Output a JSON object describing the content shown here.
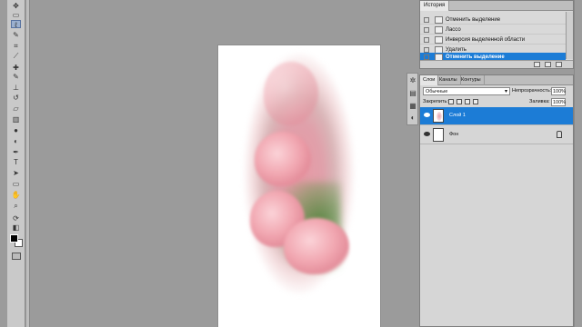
{
  "history": {
    "tab_label": "История",
    "items": [
      {
        "label": "Отменить выделение",
        "selected": false
      },
      {
        "label": "Лассо",
        "selected": false
      },
      {
        "label": "Инверсия выделенной области",
        "selected": false
      },
      {
        "label": "Удалить",
        "selected": false
      },
      {
        "label": "Отменить выделение",
        "selected": true
      }
    ]
  },
  "layers": {
    "tabs": [
      "Слои",
      "Каналы",
      "Контуры"
    ],
    "blend_mode": "Обычные",
    "opacity_label": "Непрозрачность:",
    "opacity_value": "100%",
    "lock_label": "Закрепить:",
    "fill_label": "Заливка:",
    "fill_value": "100%",
    "items": [
      {
        "name": "Слой 1",
        "selected": true,
        "visible": true,
        "locked": false
      },
      {
        "name": "Фон",
        "selected": false,
        "visible": true,
        "locked": true
      }
    ]
  },
  "toolbar": {
    "tools": [
      "move-icon",
      "marquee-icon",
      "lasso-icon",
      "quick-select-icon",
      "crop-icon",
      "eyedropper-icon",
      "healing-icon",
      "brush-icon",
      "stamp-icon",
      "history-brush-icon",
      "eraser-icon",
      "gradient-icon",
      "blur-icon",
      "dodge-icon",
      "pen-icon",
      "type-icon",
      "path-select-icon",
      "shape-icon",
      "hand-icon",
      "zoom-icon"
    ],
    "active_tool": "lasso-icon"
  },
  "colors": {
    "accent": "#1c7cd6",
    "panel": "#d6d6d6",
    "workspace": "#9b9b9b"
  }
}
